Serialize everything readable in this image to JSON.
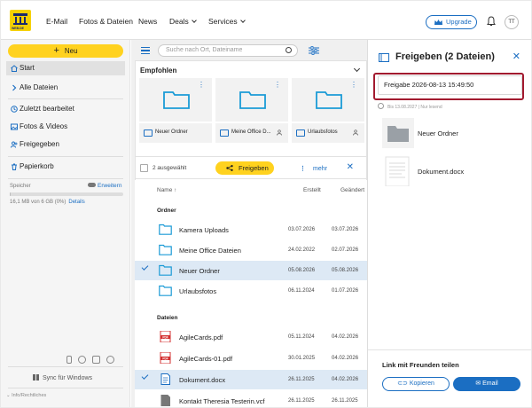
{
  "topbar": {
    "logo_text": "WEB.DE",
    "nav": [
      {
        "label": "E-Mail",
        "has_menu": false
      },
      {
        "label": "Fotos & Dateien",
        "has_menu": false
      },
      {
        "label": "News",
        "has_menu": false
      },
      {
        "label": "Deals",
        "has_menu": true
      },
      {
        "label": "Services",
        "has_menu": true
      }
    ],
    "upgrade_label": "Upgrade",
    "avatar_initials": "TT"
  },
  "sidebar": {
    "new_label": "Neu",
    "items": [
      {
        "label": "Start",
        "icon": "home-icon"
      },
      {
        "label": "Alle Dateien",
        "icon": "chevron-right-icon"
      },
      {
        "label": "Zuletzt bearbeitet",
        "icon": "clock-icon"
      },
      {
        "label": "Fotos & Videos",
        "icon": "image-icon"
      },
      {
        "label": "Freigegeben",
        "icon": "people-icon"
      },
      {
        "label": "Papierkorb",
        "icon": "trash-icon"
      }
    ],
    "storage_label": "Speicher",
    "expand_label": "Erweitern",
    "storage_used_fraction": 0.0,
    "storage_text": "16,1 MB von 6 GB (0%)",
    "details_label": "Details",
    "sync_label": "Sync für Windows",
    "imprint_label": "Info/Rechtliches"
  },
  "main": {
    "search_placeholder": "Suche nach Ort, Dateiname",
    "recommended_title": "Empfohlen",
    "recommended": [
      {
        "name": "Neuer Ordner",
        "shared": false
      },
      {
        "name": "Meine Office D...",
        "shared": true
      },
      {
        "name": "Urlaubsfotos",
        "shared": true
      }
    ],
    "selected_count": "2 ausgewählt",
    "share_label": "Freigeben",
    "more_label": "mehr",
    "columns": {
      "name": "Name",
      "created": "Erstellt",
      "modified": "Geändert"
    },
    "folders_heading": "Ordner",
    "files_heading": "Dateien",
    "folders": [
      {
        "name": "Kamera Uploads",
        "created": "03.07.2026",
        "modified": "03.07.2026",
        "selected": false
      },
      {
        "name": "Meine Office Dateien",
        "created": "24.02.2022",
        "modified": "02.07.2026",
        "selected": false
      },
      {
        "name": "Neuer Ordner",
        "created": "05.08.2026",
        "modified": "05.08.2026",
        "selected": true
      },
      {
        "name": "Urlaubsfotos",
        "created": "06.11.2024",
        "modified": "01.07.2026",
        "selected": false
      }
    ],
    "files": [
      {
        "name": "AgileCards.pdf",
        "type": "pdf",
        "created": "05.11.2024",
        "modified": "04.02.2026",
        "selected": false
      },
      {
        "name": "AgileCards-01.pdf",
        "type": "pdf",
        "created": "30.01.2025",
        "modified": "04.02.2026",
        "selected": false
      },
      {
        "name": "Dokument.docx",
        "type": "doc",
        "created": "26.11.2025",
        "modified": "04.02.2026",
        "selected": true
      },
      {
        "name": "Kontakt Theresia Testerin.vcf",
        "type": "vcf",
        "created": "26.11.2025",
        "modified": "26.11.2025",
        "selected": false
      }
    ]
  },
  "panel": {
    "title": "Freigeben (2 Dateien)",
    "share_name": "Freigabe 2026-08-13 15:49:50",
    "meta": "Bis 13.08.2027 | Nur lesend",
    "files": [
      {
        "name": "Neuer Ordner",
        "kind": "folder"
      },
      {
        "name": "Dokument.docx",
        "kind": "doc"
      }
    ],
    "link_title": "Link mit Freunden teilen",
    "copy_label": "Kopieren",
    "email_label": "Email"
  },
  "colors": {
    "accent": "#1b6ec2",
    "brand_yellow": "#ffd21f",
    "highlight": "#a21a2f",
    "selection": "#dde9f5"
  }
}
